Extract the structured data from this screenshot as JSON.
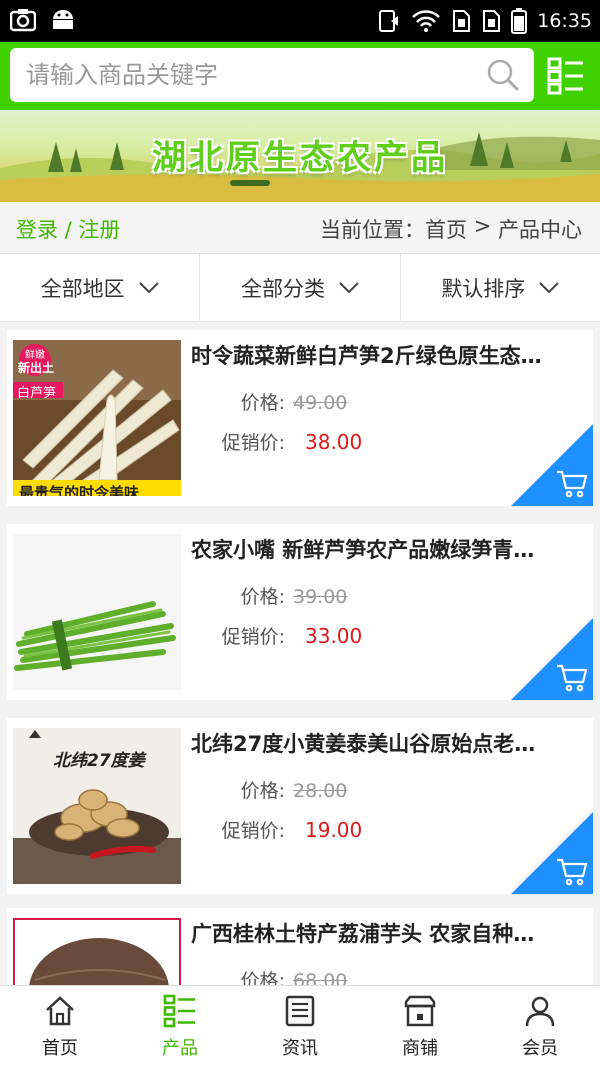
{
  "status": {
    "time": "16:35"
  },
  "search": {
    "placeholder": "请输入商品关键字"
  },
  "banner": {
    "title": "湖北原生态农产品"
  },
  "nav": {
    "login": "登录 / 注册",
    "location_label": "当前位置：",
    "home": "首页",
    "separator": " > ",
    "current": "产品中心"
  },
  "filters": [
    {
      "label": "全部地区"
    },
    {
      "label": "全部分类"
    },
    {
      "label": "默认排序"
    }
  ],
  "price_label": "价格:",
  "promo_label": "促销价:",
  "products": [
    {
      "title": "时令蔬菜新鲜白芦笋2斤绿色原生态…",
      "price": "49.00",
      "promo_price": "38.00",
      "image_texts": {
        "badge_top": "鲜嫩",
        "badge_bottom": "新出土",
        "tag": "白芦笋",
        "caption": "最贵气的时令美味"
      }
    },
    {
      "title": "农家小嘴 新鲜芦笋农产品嫩绿笋青…",
      "price": "39.00",
      "promo_price": "33.00"
    },
    {
      "title": "北纬27度小黄姜泰美山谷原始点老…",
      "price": "28.00",
      "promo_price": "19.00",
      "image_texts": {
        "headline": "北纬27度姜"
      }
    },
    {
      "title": "广西桂林土特产荔浦芋头 农家自种…",
      "price": "68.00"
    }
  ],
  "tabs": [
    {
      "label": "首页",
      "icon": "home-icon"
    },
    {
      "label": "产品",
      "icon": "product-list-icon",
      "active": true
    },
    {
      "label": "资讯",
      "icon": "news-icon"
    },
    {
      "label": "商铺",
      "icon": "shop-icon"
    },
    {
      "label": "会员",
      "icon": "member-icon"
    }
  ],
  "colors": {
    "brand_green": "#3fd100",
    "price_red": "#e01818",
    "cart_blue": "#1e90ff"
  }
}
